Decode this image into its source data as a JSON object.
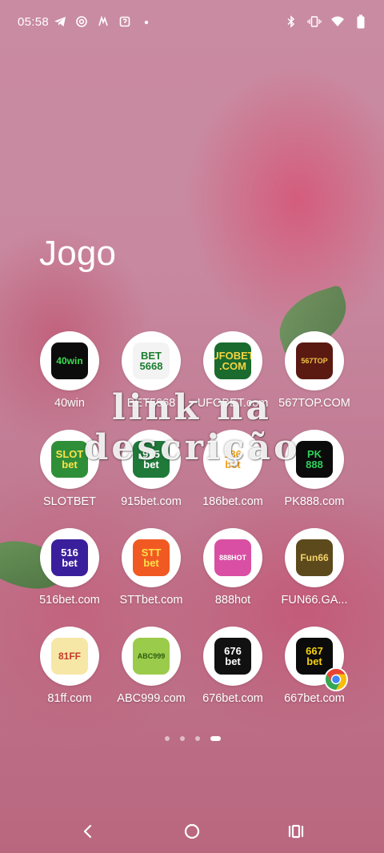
{
  "status_bar": {
    "time": "05:58",
    "left_icons": [
      "telegram-icon",
      "settings-icon",
      "app-icon",
      "app-icon",
      "dot-icon"
    ],
    "right_icons": [
      "bluetooth-icon",
      "vibrate-icon",
      "wifi-icon",
      "battery-icon"
    ]
  },
  "folder": {
    "title": "Jogo"
  },
  "apps": [
    {
      "label": "40win",
      "tile": {
        "text": "40win",
        "bg": "#0c0c0c",
        "fg": "#3ddc53"
      }
    },
    {
      "label": "BET5668",
      "tile": {
        "text": "BET\n5668",
        "bg": "#f3f3f3",
        "fg": "#1b7d2f"
      }
    },
    {
      "label": "UFOBET.com",
      "tile": {
        "text": "UFOBET\n.COM",
        "bg": "#1a6b2d",
        "fg": "#f5d442"
      }
    },
    {
      "label": "567TOP.COM",
      "tile": {
        "text": "567TOP",
        "bg": "#5a1a12",
        "fg": "#f4c542"
      }
    },
    {
      "label": "SLOTBET",
      "tile": {
        "text": "SLOT\nbet",
        "bg": "#2f8f38",
        "fg": "#ffe24a"
      }
    },
    {
      "label": "915bet.com",
      "tile": {
        "text": "915\nbet",
        "bg": "#1f7a3a",
        "fg": "#ffffff"
      }
    },
    {
      "label": "186bet.com",
      "tile": {
        "text": "186\nbet",
        "bg": "#ffffff",
        "fg": "#f2a11d"
      }
    },
    {
      "label": "PK888.com",
      "tile": {
        "text": "PK\n888",
        "bg": "#0b0b0b",
        "fg": "#2fd25b"
      }
    },
    {
      "label": "516bet.com",
      "tile": {
        "text": "516\nbet",
        "bg": "#3a1f9c",
        "fg": "#ffffff"
      }
    },
    {
      "label": "STTbet.com",
      "tile": {
        "text": "STT\nbet",
        "bg": "#f05a22",
        "fg": "#ffe14a"
      }
    },
    {
      "label": "888hot",
      "tile": {
        "text": "888HOT",
        "bg": "#d94fa3",
        "fg": "#ffffff"
      }
    },
    {
      "label": "FUN66.GA...",
      "tile": {
        "text": "Fun66",
        "bg": "#5d4a1c",
        "fg": "#f3d26a"
      }
    },
    {
      "label": "81ff.com",
      "tile": {
        "text": "81FF",
        "bg": "#f6e7a6",
        "fg": "#c7372a"
      }
    },
    {
      "label": "ABC999.com",
      "tile": {
        "text": "ABC999",
        "bg": "#9bcb4a",
        "fg": "#2b5d12"
      }
    },
    {
      "label": "676bet.com",
      "tile": {
        "text": "676\nbet",
        "bg": "#111111",
        "fg": "#ffffff"
      }
    },
    {
      "label": "667bet.com",
      "tile": {
        "text": "667\nbet",
        "bg": "#0b0b0b",
        "fg": "#f5d20b"
      }
    }
  ],
  "overlay": {
    "line1": "link na",
    "line2": "descrição"
  },
  "pager": {
    "pages": 4,
    "active": 4
  },
  "nav": {
    "back": "back-icon",
    "home": "home-icon",
    "recents": "recents-icon"
  }
}
